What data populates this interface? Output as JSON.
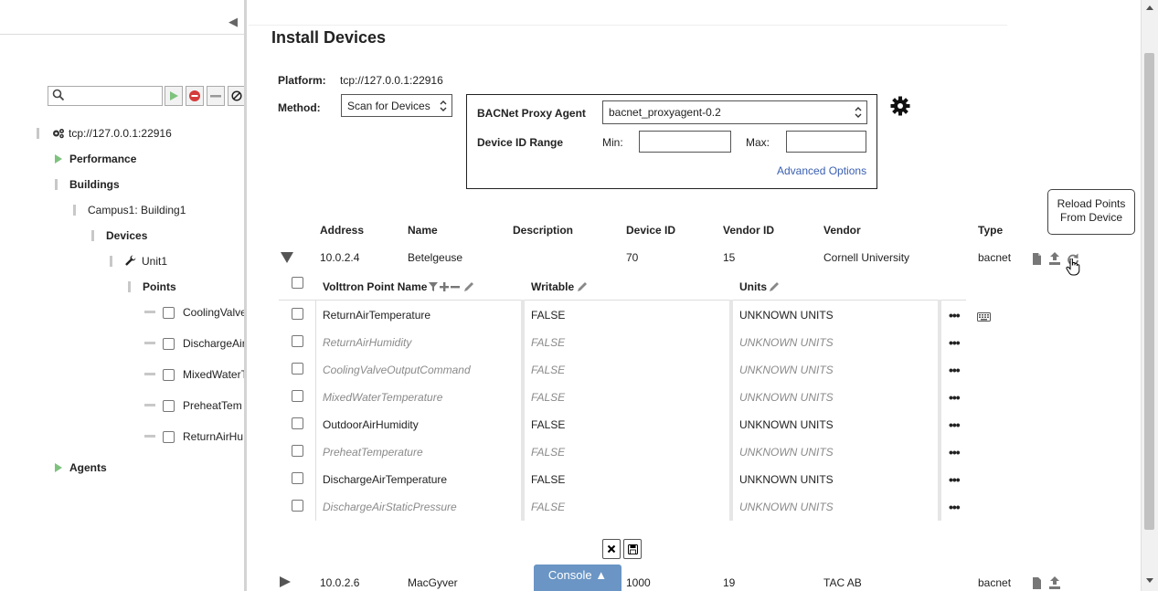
{
  "sidebar": {
    "search_placeholder": "",
    "tree": {
      "platform": "tcp://127.0.0.1:22916",
      "performance": "Performance",
      "buildings": "Buildings",
      "campus": "Campus1: Building1",
      "devices": "Devices",
      "unit": "Unit1",
      "points": "Points",
      "point_items": [
        "CoolingValve",
        "DischargeAir",
        "MixedWaterT",
        "PreheatTem",
        "ReturnAirHu"
      ],
      "agents": "Agents"
    }
  },
  "page": {
    "title": "Install Devices",
    "platform_label": "Platform:",
    "platform_value": "tcp://127.0.0.1:22916",
    "method_label": "Method:",
    "method_value": "Scan for Devices",
    "proxy_label": "BACNet Proxy Agent",
    "proxy_value": "bacnet_proxyagent-0.2",
    "range_label": "Device ID Range",
    "min_label": "Min:",
    "max_label": "Max:",
    "min_value": "",
    "max_value": "",
    "advanced_link": "Advanced Options"
  },
  "device_table": {
    "headers": {
      "address": "Address",
      "name": "Name",
      "description": "Description",
      "device_id": "Device ID",
      "vendor_id": "Vendor ID",
      "vendor": "Vendor",
      "type": "Type"
    },
    "devices": [
      {
        "address": "10.0.2.4",
        "name": "Betelgeuse",
        "description": "",
        "device_id": "70",
        "vendor_id": "15",
        "vendor": "Cornell University",
        "type": "bacnet"
      },
      {
        "address": "10.0.2.6",
        "name": "MacGyver",
        "description": "",
        "device_id": "1000",
        "vendor_id": "19",
        "vendor": "TAC AB",
        "type": "bacnet"
      }
    ]
  },
  "tooltip": {
    "line1": "Reload Points",
    "line2": "From Device"
  },
  "points_table": {
    "headers": {
      "name": "Volttron Point Name",
      "writable": "Writable",
      "units": "Units"
    },
    "rows": [
      {
        "name": "ReturnAirTemperature",
        "writable": "FALSE",
        "units": "UNKNOWN UNITS",
        "dim": false
      },
      {
        "name": "ReturnAirHumidity",
        "writable": "FALSE",
        "units": "UNKNOWN UNITS",
        "dim": true
      },
      {
        "name": "CoolingValveOutputCommand",
        "writable": "FALSE",
        "units": "UNKNOWN UNITS",
        "dim": true
      },
      {
        "name": "MixedWaterTemperature",
        "writable": "FALSE",
        "units": "UNKNOWN UNITS",
        "dim": true
      },
      {
        "name": "OutdoorAirHumidity",
        "writable": "FALSE",
        "units": "UNKNOWN UNITS",
        "dim": false
      },
      {
        "name": "PreheatTemperature",
        "writable": "FALSE",
        "units": "UNKNOWN UNITS",
        "dim": true
      },
      {
        "name": "DischargeAirTemperature",
        "writable": "FALSE",
        "units": "UNKNOWN UNITS",
        "dim": false
      },
      {
        "name": "DischargeAirStaticPressure",
        "writable": "FALSE",
        "units": "UNKNOWN UNITS",
        "dim": true
      }
    ]
  },
  "console": {
    "label": "Console ▲"
  },
  "colors": {
    "accent_link": "#3a5fb0",
    "console_bg": "#6a95c4",
    "tree_arrow": "#7ec27e",
    "dim_text": "#8a8a8a"
  }
}
